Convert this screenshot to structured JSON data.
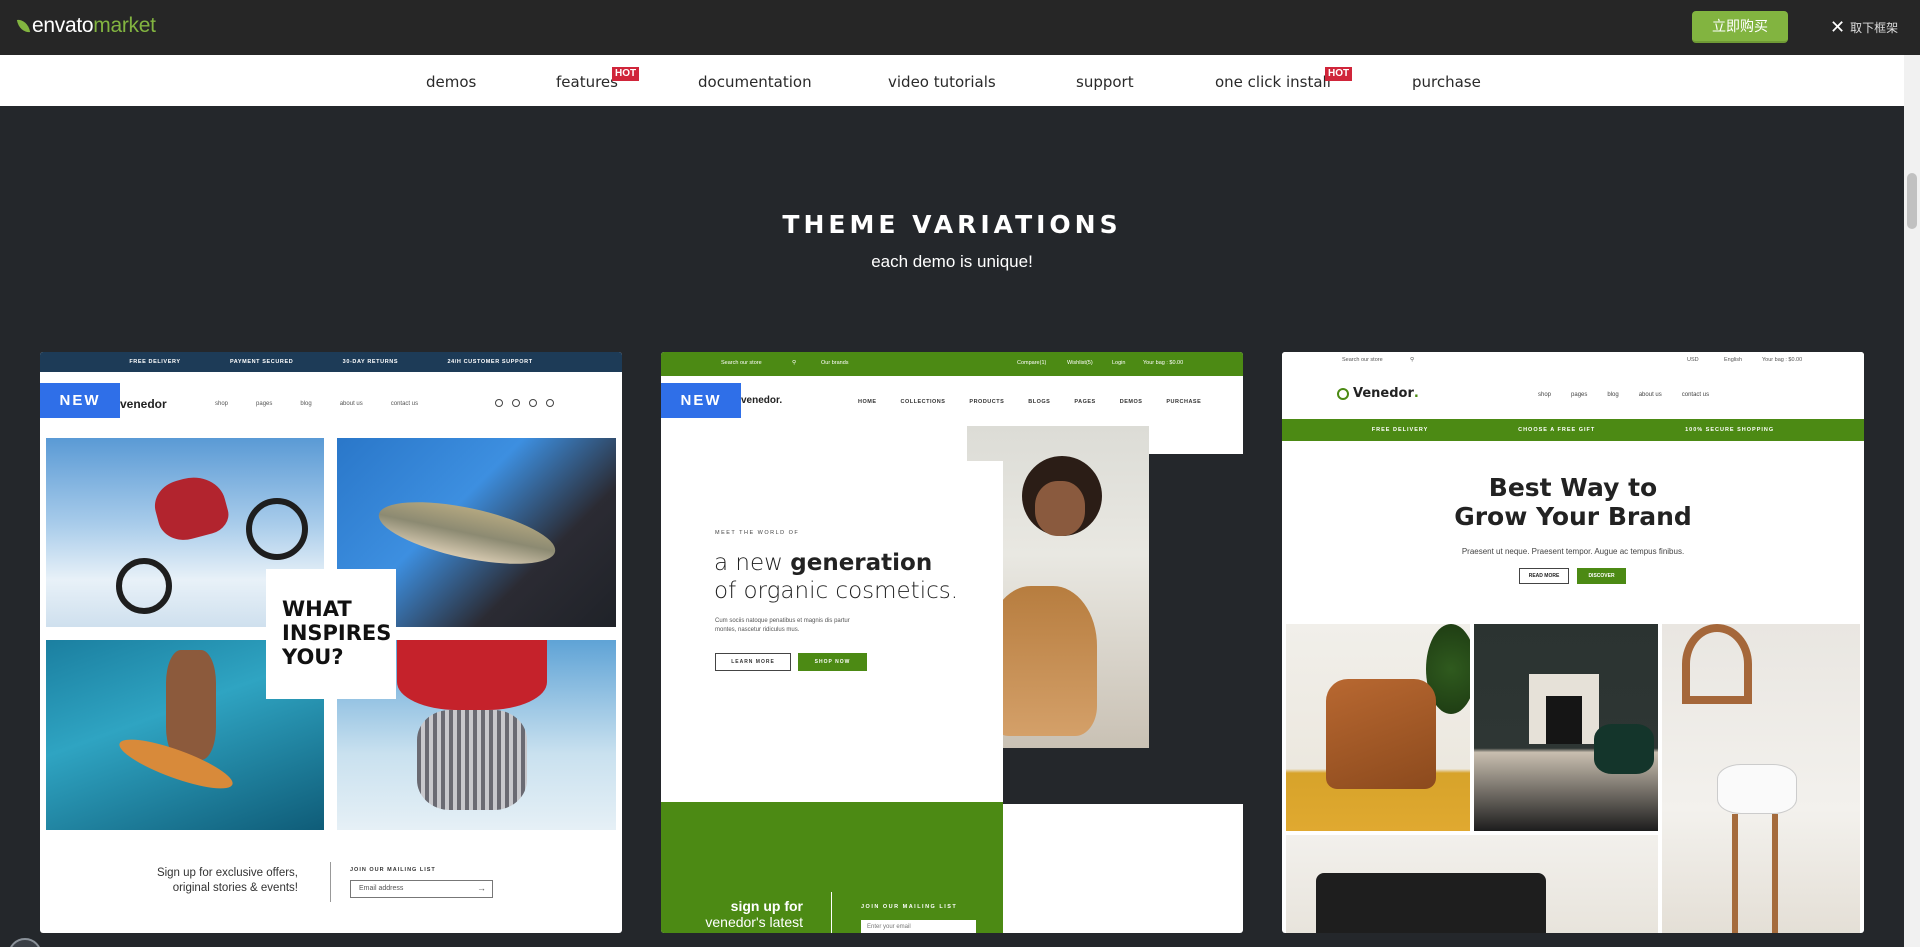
{
  "topbar": {
    "logo_main": "envato",
    "logo_accent": "market",
    "buy_label": "立即购买",
    "close_label": "取下框架"
  },
  "nav": {
    "items": [
      {
        "label": "demos",
        "hot": false
      },
      {
        "label": "features",
        "hot": true
      },
      {
        "label": "documentation",
        "hot": false
      },
      {
        "label": "video tutorials",
        "hot": false
      },
      {
        "label": "support",
        "hot": false
      },
      {
        "label": "one click install",
        "hot": true
      },
      {
        "label": "purchase",
        "hot": false
      }
    ],
    "hot_label": "HOT"
  },
  "section": {
    "title": "THEME VARIATIONS",
    "subtitle": "each demo is unique!"
  },
  "cards": [
    {
      "badge": "NEW",
      "strip": [
        "FREE DELIVERY",
        "PAYMENT SECURED",
        "30-DAY RETURNS",
        "24/H CUSTOMER SUPPORT"
      ],
      "logo": "venedor",
      "menu": [
        "shop",
        "pages",
        "blog",
        "about us",
        "contact us"
      ],
      "overlay": [
        "WHAT",
        "INSPIRES",
        "YOU?"
      ],
      "signup_line1": "Sign up for exclusive offers,",
      "signup_line2": "original stories & events!",
      "join_label": "JOIN OUR MAILING LIST",
      "email_placeholder": "Email address"
    },
    {
      "badge": "NEW",
      "top": {
        "search": "Search our store",
        "brands": "Our brands",
        "compare": "Compare(1)",
        "wishlist": "Wishlist(5)",
        "login": "Login",
        "bag": "Your bag : $0.00"
      },
      "logo": "venedor.",
      "menu": [
        "HOME",
        "COLLECTIONS",
        "PRODUCTS",
        "BLOGS",
        "PAGES",
        "DEMOS",
        "PURCHASE"
      ],
      "kicker": "MEET THE WORLD OF",
      "headline_pre": "a new ",
      "headline_bold": "generation",
      "headline_line2": "of organic cosmetics.",
      "body_line1": "Cum sociis natoque penatibus et magnis dis partur",
      "body_line2": "montes, nascetur ridiculus mus.",
      "btn_learn": "LEARN MORE",
      "btn_shop": "SHOP NOW",
      "signup_bold": "sign up for",
      "signup_rest": "venedor's latest",
      "join_label": "JOIN OUR MAILING LIST",
      "email_placeholder": "Enter your email"
    },
    {
      "top": {
        "search": "Search our store",
        "currency": "USD",
        "language": "English",
        "bag": "Your bag : $0.00"
      },
      "logo": "Venedor",
      "logo_dot": ".",
      "menu": [
        "shop",
        "pages",
        "blog",
        "about us",
        "contact us"
      ],
      "strip": [
        "FREE DELIVERY",
        "CHOOSE A FREE GIFT",
        "100% SECURE SHOPPING"
      ],
      "headline_line1": "Best Way to",
      "headline_line2": "Grow Your Brand",
      "sub": "Praesent ut neque. Praesent tempor. Augue ac tempus finibus.",
      "btn_read": "READ MORE",
      "btn_discover": "DISCOVER"
    }
  ],
  "colors": {
    "envato_green": "#82b440",
    "hot_red": "#d0253a",
    "new_blue": "#2f6fe8",
    "theme_green": "#4c8a14",
    "page_bg": "#24272b"
  }
}
